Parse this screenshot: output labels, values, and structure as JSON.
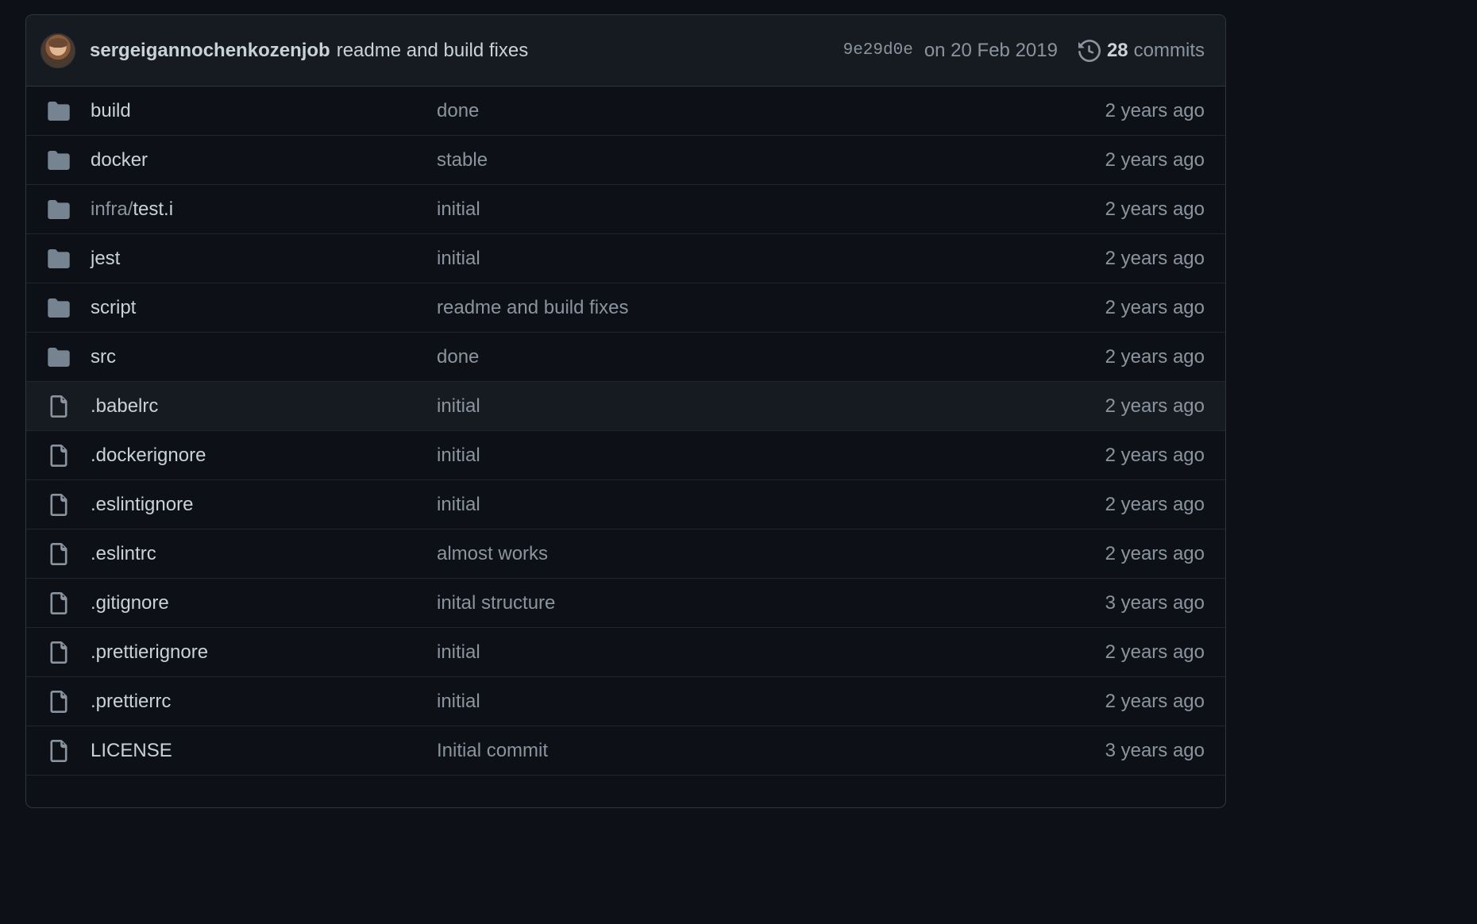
{
  "latest_commit": {
    "author": "sergeigannochenkozenjob",
    "message": "readme and build fixes",
    "sha": "9e29d0e",
    "date": "on 20 Feb 2019",
    "commit_count": "28",
    "commits_label": "commits"
  },
  "colors": {
    "folder": "#768390",
    "file": "#8b949e",
    "background": "#0d1117"
  },
  "entries": [
    {
      "type": "folder",
      "prefix": "",
      "name": "build",
      "message": "done",
      "age": "2 years ago"
    },
    {
      "type": "folder",
      "prefix": "",
      "name": "docker",
      "message": "stable",
      "age": "2 years ago"
    },
    {
      "type": "folder",
      "prefix": "infra/",
      "name": "test.i",
      "message": "initial",
      "age": "2 years ago"
    },
    {
      "type": "folder",
      "prefix": "",
      "name": "jest",
      "message": "initial",
      "age": "2 years ago"
    },
    {
      "type": "folder",
      "prefix": "",
      "name": "script",
      "message": "readme and build fixes",
      "age": "2 years ago"
    },
    {
      "type": "folder",
      "prefix": "",
      "name": "src",
      "message": "done",
      "age": "2 years ago"
    },
    {
      "type": "file",
      "prefix": "",
      "name": ".babelrc",
      "message": "initial",
      "age": "2 years ago"
    },
    {
      "type": "file",
      "prefix": "",
      "name": ".dockerignore",
      "message": "initial",
      "age": "2 years ago"
    },
    {
      "type": "file",
      "prefix": "",
      "name": ".eslintignore",
      "message": "initial",
      "age": "2 years ago"
    },
    {
      "type": "file",
      "prefix": "",
      "name": ".eslintrc",
      "message": "almost works",
      "age": "2 years ago"
    },
    {
      "type": "file",
      "prefix": "",
      "name": ".gitignore",
      "message": "inital structure",
      "age": "3 years ago"
    },
    {
      "type": "file",
      "prefix": "",
      "name": ".prettierignore",
      "message": "initial",
      "age": "2 years ago"
    },
    {
      "type": "file",
      "prefix": "",
      "name": ".prettierrc",
      "message": "initial",
      "age": "2 years ago"
    },
    {
      "type": "file",
      "prefix": "",
      "name": "LICENSE",
      "message": "Initial commit",
      "age": "3 years ago"
    }
  ]
}
